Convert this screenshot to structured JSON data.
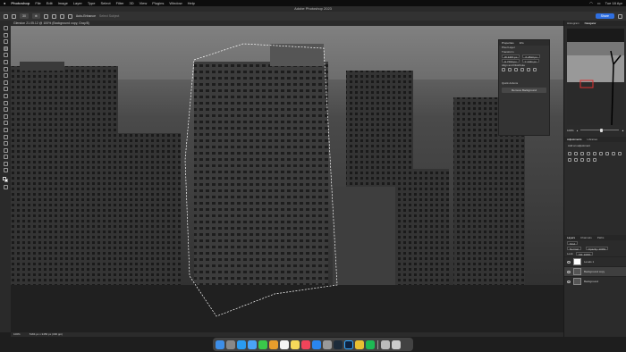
{
  "menubar": {
    "app_name": "Photoshop",
    "menus": [
      "File",
      "Edit",
      "Image",
      "Layer",
      "Type",
      "Select",
      "Filter",
      "3D",
      "View",
      "Plugins",
      "Window",
      "Help"
    ],
    "clock": "Tue 18 Apr"
  },
  "window": {
    "title": "Adobe Photoshop 2023"
  },
  "options_bar": {
    "auto_enhance": "Auto-Enhance",
    "select_subject": "Select Subject",
    "share": "Share"
  },
  "document_tab": {
    "label": "Glendon 21.05.12 @ 100% (Background copy, Gray/8)"
  },
  "status": {
    "zoom": "100%",
    "doc_info": "5184 px x 3456 px (300 ppi)"
  },
  "properties": {
    "tabs": [
      "Properties",
      "Info"
    ],
    "pixel_layer": "Pixel Layer",
    "transform": "Transform",
    "w": "W 3467 px",
    "h": "H 7194 px",
    "x": "X 2813 px",
    "y": "Y 1411 px",
    "align": "Align and Distribute",
    "quick_actions": "Quick Actions",
    "remove_bg": "Remove Background"
  },
  "navigator": {
    "tabs": [
      "Histogram",
      "Navigator"
    ],
    "zoom": "100%"
  },
  "adjustments": {
    "tabs": [
      "Adjustments",
      "Libraries"
    ],
    "add_label": "Add an adjustment"
  },
  "layers": {
    "tabs": [
      "Layers",
      "Channels",
      "Paths"
    ],
    "kind": "Kind",
    "blend": "Normal",
    "opacity": "Opacity: 100%",
    "lock": "Lock:",
    "fill": "Fill: 100%",
    "items": [
      {
        "name": "Levels 1"
      },
      {
        "name": "Background copy"
      },
      {
        "name": "Background"
      }
    ]
  },
  "colors": {
    "accent": "#2f6fe0",
    "selection_marker": "#e03030"
  }
}
